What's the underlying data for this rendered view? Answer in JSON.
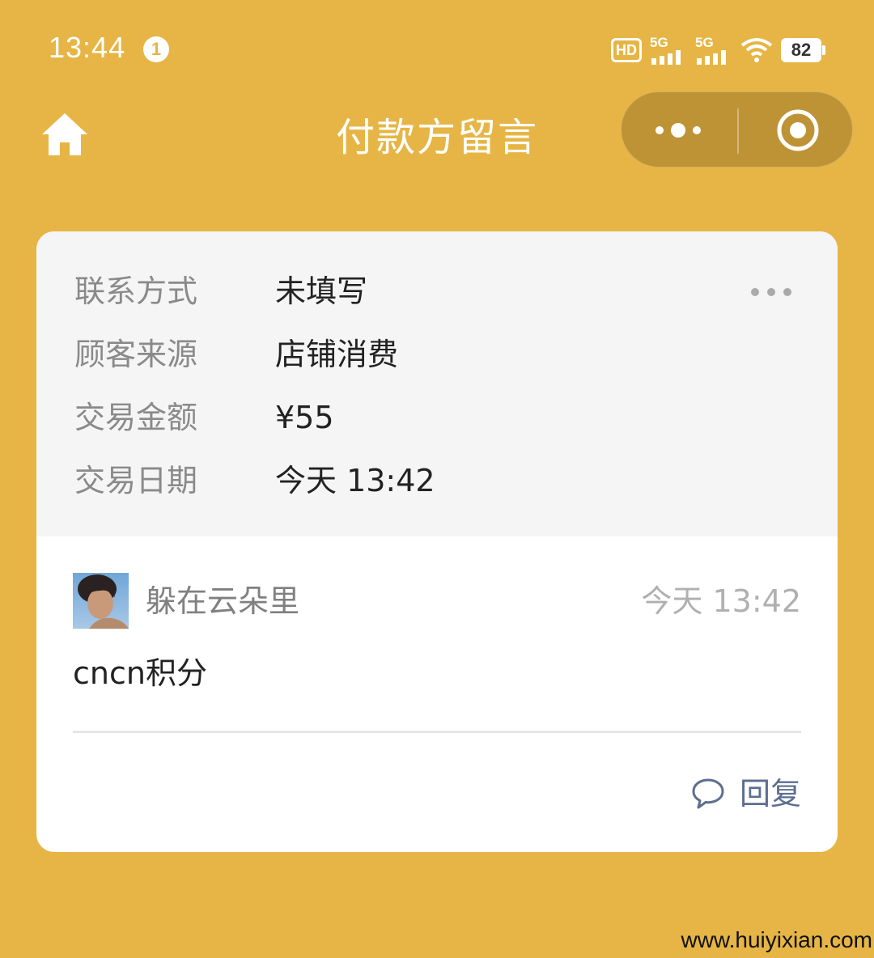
{
  "status_bar": {
    "time": "13:44",
    "notification_count": "1",
    "hd_label": "HD",
    "sim1_label": "5G",
    "sim2_label": "5G",
    "battery_level": "82"
  },
  "nav": {
    "title": "付款方留言",
    "home_icon": "home-icon",
    "more_icon": "more-dots-icon",
    "close_icon": "target-circle-icon"
  },
  "info": {
    "rows": [
      {
        "label": "联系方式",
        "value": "未填写"
      },
      {
        "label": "顾客来源",
        "value": "店铺消费"
      },
      {
        "label": "交易金额",
        "value": "¥55"
      },
      {
        "label": "交易日期",
        "value": "今天 13:42"
      }
    ]
  },
  "comment": {
    "author": "躲在云朵里",
    "time": "今天 13:42",
    "text": "cncn积分",
    "reply_label": "回复"
  },
  "watermark": "www.huiyixian.com",
  "colors": {
    "background": "#E6B545",
    "capsule": "#BE9336",
    "reply": "#5D6E8F"
  }
}
